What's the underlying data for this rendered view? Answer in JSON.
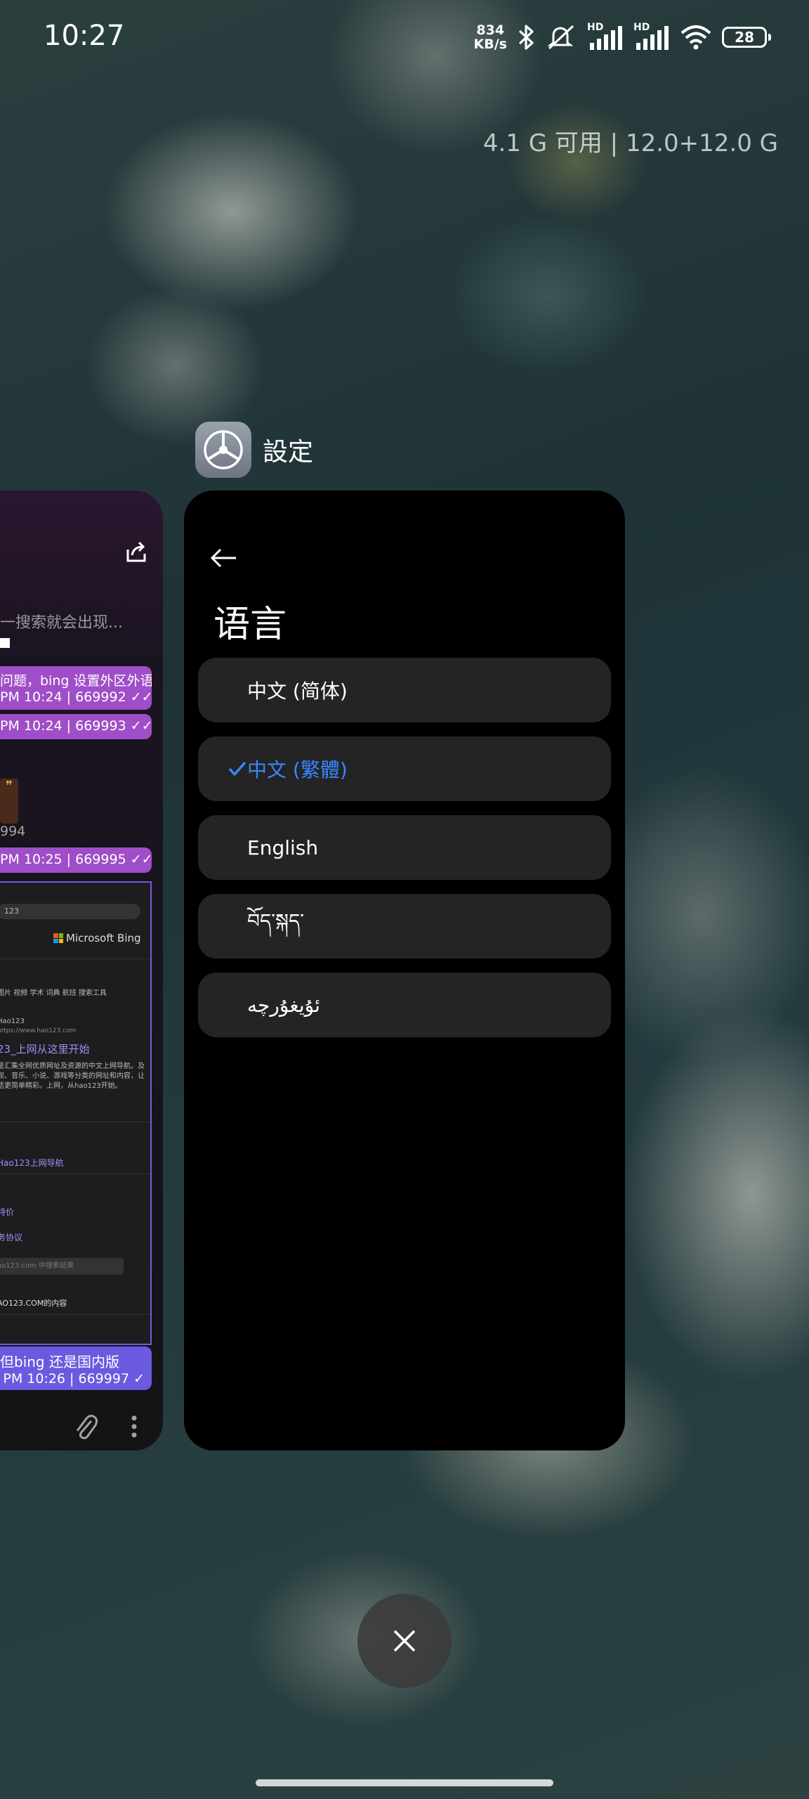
{
  "status_bar": {
    "time": "10:27",
    "net_speed_value": "834",
    "net_speed_unit": "KB/s",
    "signal1_label": "HD",
    "signal2_label": "HD",
    "battery_level": "28"
  },
  "recents": {
    "memory_info": "4.1 G 可用 | 12.0+12.0 G"
  },
  "chat_card": {
    "search_hint": "一搜索就会出现...",
    "messages": [
      {
        "text": "问题，bing 设置外区外语",
        "meta": "PM 10:24 | 669992 ✓✓"
      },
      {
        "text": "",
        "meta": "PM 10:24 | 669993 ✓✓"
      },
      {
        "text": "",
        "meta": "PM 10:25 | 669995 ✓✓"
      },
      {
        "text": "但bing 还是国内版",
        "meta": "PM 10:26 | 669997 ✓"
      }
    ],
    "number_fragment": "994",
    "screenshot": {
      "search_text": "123",
      "bing_label": "Microsoft Bing",
      "filters": "图片  视频  学术  词典  航班  搜索工具",
      "site_name": "Hao123",
      "site_url": "https://www.hao123.com",
      "result_title": "23_上网从这里开始",
      "snippet1": "是汇集全网优质网址及资源的中文上网导航。及",
      "snippet2": "视、音乐、小说、游戏等分类的网址和内容，让",
      "snippet3": "活更简单精彩。上网，从hao123开始。",
      "link1": "Hao123上网导航",
      "link2": "特价",
      "link3": "务协议",
      "search_box": "ao123.com 中搜索结果",
      "footer": "AO123.COM的内容"
    }
  },
  "settings_card": {
    "app_name": "設定",
    "title": "语言",
    "languages": [
      {
        "label": "中文 (简体)",
        "selected": false
      },
      {
        "label": "中文 (繁體)",
        "selected": true
      },
      {
        "label": "English",
        "selected": false
      },
      {
        "label": "བོད་སྐད་",
        "selected": false
      },
      {
        "label": "ئۇيغۇرچە",
        "selected": false
      }
    ]
  },
  "colors": {
    "accent": "#3a86ff",
    "card_bg": "#000000",
    "item_bg": "#242424",
    "bubble": "#a04ec8"
  },
  "icons": [
    "bluetooth-icon",
    "mute-icon",
    "signal-icon",
    "wifi-icon",
    "battery-icon",
    "back-arrow-icon",
    "check-icon",
    "close-icon",
    "settings-gear-icon",
    "share-icon",
    "paperclip-icon",
    "more-dots-icon"
  ]
}
